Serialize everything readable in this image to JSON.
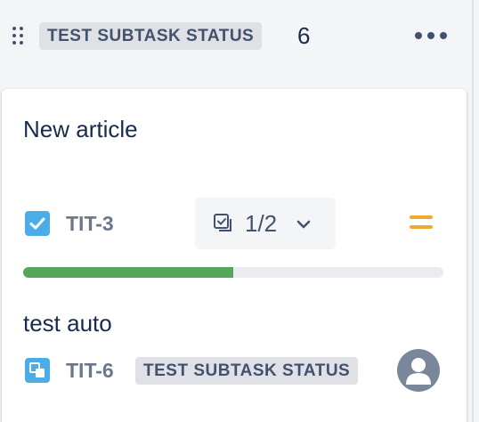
{
  "column": {
    "title": "TEST SUBTASK STATUS",
    "count": "6"
  },
  "card": {
    "summary": "New article",
    "key": "TIT-3",
    "issue_type_icon": "checkbox-icon",
    "subtasks": {
      "count_label": "1/2",
      "done": 1,
      "total": 2
    },
    "priority_icon": "priority-medium-icon",
    "progress_fraction": 0.5
  },
  "subtask_row": {
    "summary": "test auto",
    "key": "TIT-6",
    "issue_type_icon": "subtask-icon",
    "status": "TEST SUBTASK STATUS",
    "assignee_icon": "default-avatar-icon"
  },
  "colors": {
    "accent_blue": "#4bade8",
    "progress_green": "#57a55a",
    "priority_orange": "#f0a830"
  }
}
